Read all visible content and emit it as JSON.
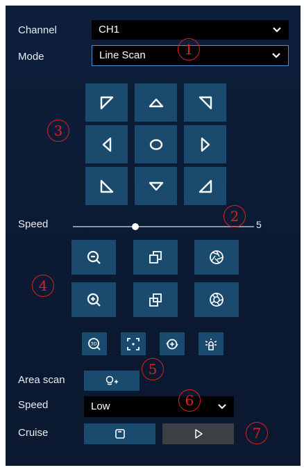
{
  "channel": {
    "label": "Channel",
    "value": "CH1"
  },
  "mode": {
    "label": "Mode",
    "value": "Line Scan"
  },
  "speed": {
    "label": "Speed",
    "value": "5",
    "level_fraction": 0.345
  },
  "area_scan": {
    "label": "Area scan"
  },
  "scan_speed": {
    "label": "Speed",
    "value": "Low"
  },
  "cruise": {
    "label": "Cruise"
  },
  "markers": [
    "1",
    "2",
    "3",
    "4",
    "5",
    "6",
    "7"
  ],
  "icons": {
    "ptz": [
      "up-left-arrow-icon",
      "up-arrow-icon",
      "up-right-arrow-icon",
      "left-arrow-icon",
      "center-circle-icon",
      "right-arrow-icon",
      "down-left-arrow-icon",
      "down-arrow-icon",
      "down-right-arrow-icon"
    ],
    "lens": [
      "zoom-out-icon",
      "focus-near-icon",
      "iris-close-icon",
      "zoom-in-icon",
      "focus-far-icon",
      "iris-open-icon"
    ],
    "extra": [
      "3d-zoom-icon",
      "fit-frame-icon",
      "rotate-icon",
      "light-icon"
    ]
  },
  "colors": {
    "panel": "#0c1c35",
    "button": "#1a4a6e",
    "marker": "#e02020",
    "select_border": "#4a90d9"
  }
}
